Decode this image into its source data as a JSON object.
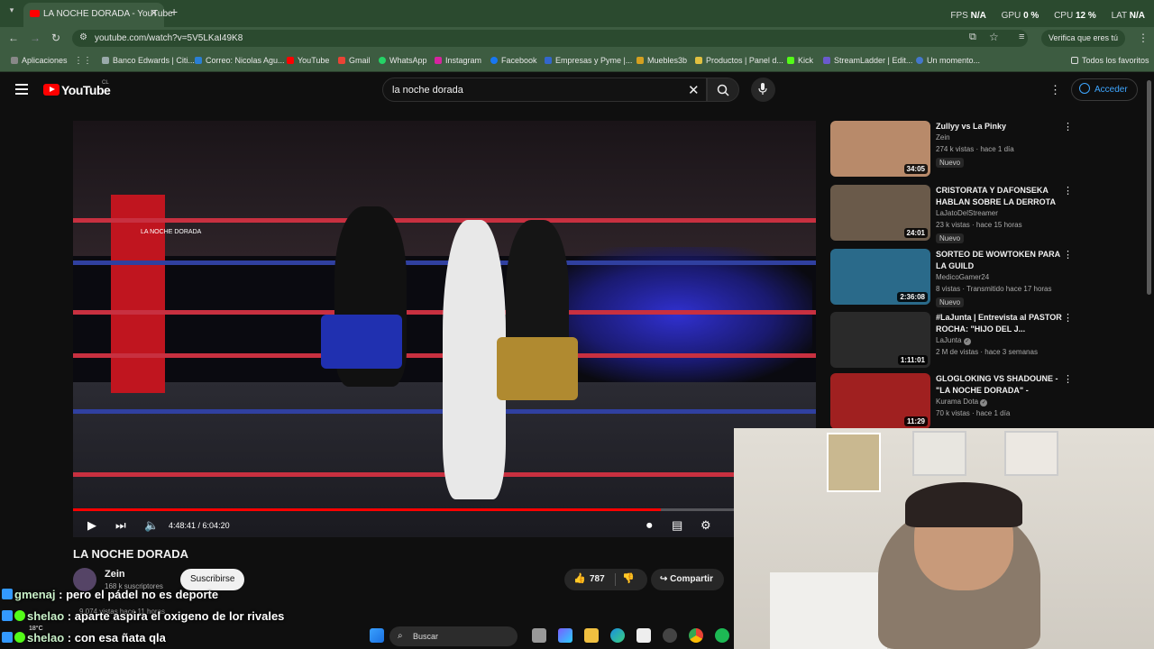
{
  "browser": {
    "tab_title": "LA NOCHE DORADA - YouTube",
    "url": "youtube.com/watch?v=5V5LKaI49K8",
    "verify_label": "Verifica que eres tú",
    "stats": [
      {
        "label": "FPS",
        "value": "N/A"
      },
      {
        "label": "GPU",
        "value": "0 %"
      },
      {
        "label": "CPU",
        "value": "12 %"
      },
      {
        "label": "LAT",
        "value": "N/A"
      }
    ],
    "bookmarks": [
      {
        "label": "Aplicaciones",
        "color": "#888"
      },
      {
        "label": "Banco Edwards | Citi...",
        "color": "#9aa"
      },
      {
        "label": "Correo: Nicolas Agu...",
        "color": "#2a7fd4"
      },
      {
        "label": "YouTube",
        "color": "#ff0000"
      },
      {
        "label": "Gmail",
        "color": "#ea4335"
      },
      {
        "label": "WhatsApp",
        "color": "#25d366"
      },
      {
        "label": "Instagram",
        "color": "#d6249f"
      },
      {
        "label": "Facebook",
        "color": "#1877f2"
      },
      {
        "label": "Empresas y Pyme |...",
        "color": "#3366cc"
      },
      {
        "label": "Muebles3b",
        "color": "#d4a020"
      },
      {
        "label": "Productos | Panel d...",
        "color": "#e0c040"
      },
      {
        "label": "Kick",
        "color": "#53fc18"
      },
      {
        "label": "StreamLadder | Edit...",
        "color": "#6a5acd"
      },
      {
        "label": "Un momento...",
        "color": "#4477cc"
      }
    ],
    "all_favorites": "Todos los favoritos"
  },
  "youtube": {
    "logo_text": "YouTube",
    "logo_country": "CL",
    "search_value": "la noche dorada",
    "signin_label": "Acceder"
  },
  "video": {
    "title": "LA NOCHE DORADA",
    "current_time": "4:48:41",
    "duration": "6:04:20",
    "progress_fraction": 0.7917,
    "channel": "Zein",
    "subscribers": "168 k suscriptores",
    "subscribe_label": "Suscribirse",
    "likes": "787",
    "share_label": "Compartir",
    "views_meta": "9.074 vistas  hace 11 horas",
    "post_logo": "LA NOCHE DORADA"
  },
  "recommendations": [
    {
      "title": "Zullyy vs La Pinky",
      "channel": "Zein",
      "meta": "274 k vistas · hace 1 día",
      "duration": "34:05",
      "badge": "Nuevo",
      "verified": false,
      "thumb": "#b88a6a"
    },
    {
      "title": "CRISTORATA Y DAFONSEKA HABLAN SOBRE LA DERROTA ...",
      "channel": "LaJatoDelStreamer",
      "meta": "23 k vistas · hace 15 horas",
      "duration": "24:01",
      "badge": "Nuevo",
      "verified": false,
      "thumb": "#6a5a4a"
    },
    {
      "title": "SORTEO DE WOWTOKEN PARA LA GUILD",
      "channel": "MedicoGamer24",
      "meta": "8 vistas · Transmitido hace 17 horas",
      "duration": "2:36:08",
      "badge": "Nuevo",
      "verified": false,
      "thumb": "#2a6a8a"
    },
    {
      "title": "#LaJunta | Entrevista al PASTOR ROCHA: \"HIJO DEL J...",
      "channel": "LaJunta",
      "meta": "2 M de vistas · hace 3 semanas",
      "duration": "1:11:01",
      "badge": "",
      "verified": true,
      "thumb": "#2a2a2a"
    },
    {
      "title": "GLOGLOKING VS SHADOUNE - \"LA NOCHE DORADA\" - ELZEEI...",
      "channel": "Kurama Dota",
      "meta": "70 k vistas · hace 1 día",
      "duration": "11:29",
      "badge": "",
      "verified": true,
      "thumb": "#a02020"
    }
  ],
  "chat": [
    {
      "user": "gmenaj",
      "message": "pero el pádel no es deporte"
    },
    {
      "user": "shelao",
      "message": "aparte aspira el oxigeno de lor rivales"
    },
    {
      "user": "shelao",
      "message": "con esa ñata qla"
    }
  ],
  "taskbar": {
    "search_label": "Buscar",
    "weather": "18°C"
  }
}
